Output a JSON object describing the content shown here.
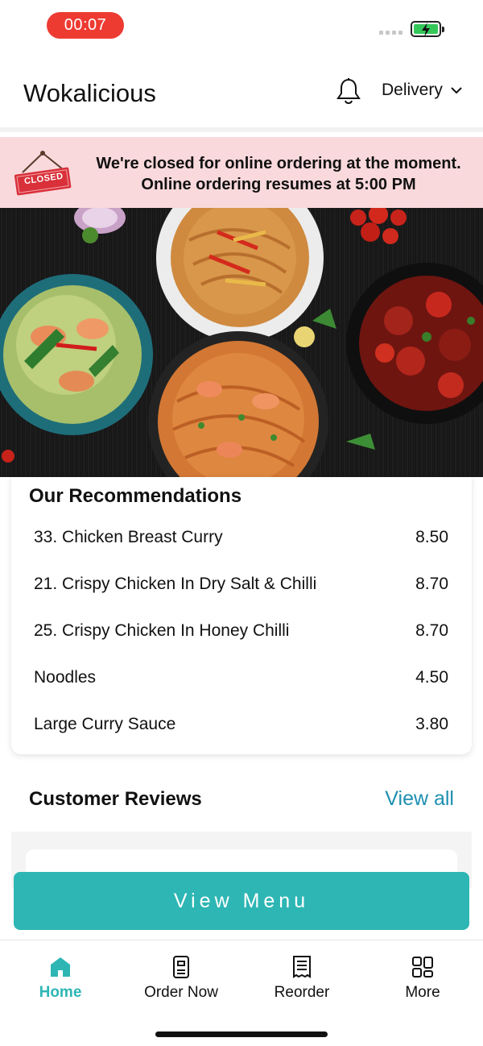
{
  "status_bar": {
    "recording_time": "00:07"
  },
  "header": {
    "title": "Wokalicious",
    "mode": "Delivery"
  },
  "banner": {
    "sign_text": "CLOSED",
    "line1": "We're closed for online ordering at the moment.",
    "line2": "Online ordering resumes at 5:00 PM"
  },
  "recommendations": {
    "title": "Our Recommendations",
    "items": [
      {
        "name": "33. Chicken Breast Curry",
        "price": "8.50"
      },
      {
        "name": "21. Crispy Chicken In Dry Salt & Chilli",
        "price": "8.70"
      },
      {
        "name": "25. Crispy Chicken In Honey Chilli",
        "price": "8.70"
      },
      {
        "name": "Noodles",
        "price": "4.50"
      },
      {
        "name": "Large Curry Sauce",
        "price": "3.80"
      }
    ]
  },
  "reviews": {
    "title": "Customer Reviews",
    "view_all": "View all"
  },
  "cta": {
    "label": "View Menu"
  },
  "tabs": [
    {
      "label": "Home",
      "icon": "home-icon"
    },
    {
      "label": "Order Now",
      "icon": "order-icon"
    },
    {
      "label": "Reorder",
      "icon": "receipt-icon"
    },
    {
      "label": "More",
      "icon": "grid-icon"
    }
  ],
  "colors": {
    "accent": "#2db6b4",
    "link": "#1e8fb0",
    "banner_bg": "#f9d9dc",
    "closed_red": "#d9303a",
    "recording": "#ee3b32"
  }
}
